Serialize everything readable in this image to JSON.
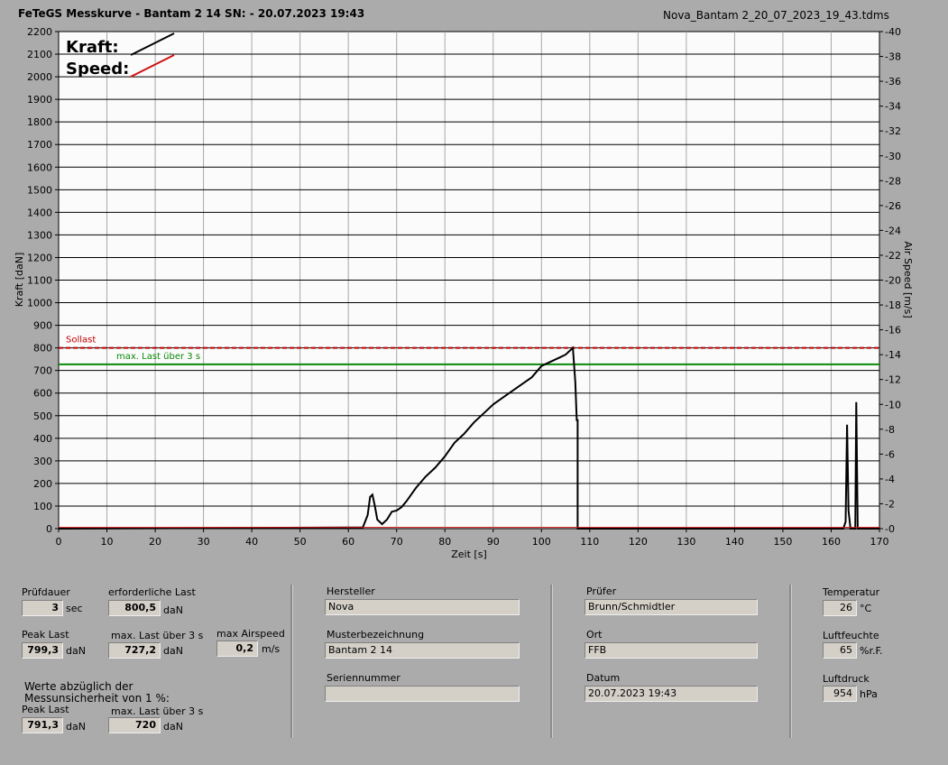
{
  "header": {
    "title": "FeTeGS Messkurve - Bantam 2 14  SN:  - 20.07.2023 19:43",
    "filename": "Nova_Bantam 2_20_07_2023_19_43.tdms"
  },
  "colors": {
    "background": "#ababab",
    "plot_bg": "#fbfbfb",
    "kraft": "#000000",
    "speed": "#d01010",
    "sollast": "#c00000",
    "maxlast": "#0a8a0a"
  },
  "chart_data": {
    "type": "line",
    "xlabel": "Zeit [s]",
    "ylabel": "Kraft [daN]",
    "y2label": "Air Speed [m/s]",
    "xlim": [
      0,
      170
    ],
    "ylim": [
      0,
      2200
    ],
    "y2lim": [
      0,
      40
    ],
    "xticks": [
      0,
      10,
      20,
      30,
      40,
      50,
      60,
      70,
      80,
      90,
      100,
      110,
      120,
      130,
      140,
      150,
      160,
      170
    ],
    "yticks": [
      0,
      100,
      200,
      300,
      400,
      500,
      600,
      700,
      800,
      900,
      1000,
      1100,
      1200,
      1300,
      1400,
      1500,
      1600,
      1700,
      1800,
      1900,
      2000,
      2100,
      2200
    ],
    "y2ticks": [
      0,
      2,
      4,
      6,
      8,
      10,
      12,
      14,
      16,
      18,
      20,
      22,
      24,
      26,
      28,
      30,
      32,
      34,
      36,
      38,
      40
    ],
    "grid": true,
    "legend": {
      "position": "top-left",
      "entries": [
        {
          "label": "Kraft:",
          "color": "#000000"
        },
        {
          "label": "Speed:",
          "color": "#d01010"
        }
      ]
    },
    "reference_lines": [
      {
        "label": "Sollast",
        "y": 800,
        "color": "#c00000",
        "style": "dashed"
      },
      {
        "label": "max. Last über  3 s",
        "y": 727,
        "color": "#0a8a0a",
        "style": "solid"
      }
    ],
    "series": [
      {
        "name": "Kraft:",
        "axis": "left",
        "x": [
          0,
          63,
          64,
          64.5,
          65,
          65.5,
          66,
          67,
          68,
          69,
          70,
          71,
          72,
          74,
          76,
          78,
          80,
          82,
          84,
          86,
          88,
          90,
          92,
          94,
          96,
          98,
          100,
          102,
          104,
          105,
          106,
          106.5,
          107,
          107.3,
          107.5,
          107.5,
          108,
          150,
          160,
          162.5,
          163,
          163.3,
          163.6,
          164,
          165,
          165.2,
          165.5,
          166,
          170
        ],
        "y": [
          0,
          5,
          60,
          140,
          150,
          100,
          40,
          20,
          40,
          75,
          80,
          95,
          120,
          180,
          230,
          270,
          320,
          380,
          420,
          470,
          510,
          550,
          580,
          610,
          640,
          670,
          720,
          740,
          760,
          770,
          790,
          800,
          650,
          480,
          480,
          0,
          0,
          0,
          0,
          0,
          30,
          460,
          80,
          0,
          0,
          560,
          0,
          0,
          0
        ]
      },
      {
        "name": "Speed:",
        "axis": "right",
        "x": [
          0,
          170
        ],
        "y": [
          0.1,
          0.1
        ]
      }
    ]
  },
  "panel": {
    "pruefdauer": {
      "label": "Prüfdauer",
      "value": "3",
      "unit": "sec"
    },
    "erforderliche_last": {
      "label": "erforderliche Last",
      "value": "800,5",
      "unit": "daN"
    },
    "peak_last": {
      "label": "Peak Last",
      "value": "799,3",
      "unit": "daN"
    },
    "max_last": {
      "label": "max. Last über  3 s",
      "value": "727,2",
      "unit": "daN"
    },
    "max_airspeed": {
      "label": "max Airspeed",
      "value": "0,2",
      "unit": "m/s"
    },
    "werte_note": "Werte abzüglich der",
    "werte_note2": "Messunsicherheit von 1   %:",
    "peak_last_corr": {
      "label": "Peak Last",
      "value": "791,3",
      "unit": "daN"
    },
    "max_last_corr": {
      "label": "max. Last über  3 s",
      "value": "720",
      "unit": "daN"
    },
    "hersteller": {
      "label": "Hersteller",
      "value": "Nova"
    },
    "musterbezeichnung": {
      "label": "Musterbezeichnung",
      "value": "Bantam 2 14"
    },
    "seriennummer": {
      "label": "Seriennummer",
      "value": ""
    },
    "pruefer": {
      "label": "Prüfer",
      "value": "Brunn/Schmidtler"
    },
    "ort": {
      "label": "Ort",
      "value": "FFB"
    },
    "datum": {
      "label": "Datum",
      "value": "20.07.2023 19:43"
    },
    "temperatur": {
      "label": "Temperatur",
      "value": "26",
      "unit": "°C"
    },
    "luftfeuchte": {
      "label": "Luftfeuchte",
      "value": "65",
      "unit": "%r.F."
    },
    "luftdruck": {
      "label": "Luftdruck",
      "value": "954",
      "unit": "hPa"
    }
  }
}
